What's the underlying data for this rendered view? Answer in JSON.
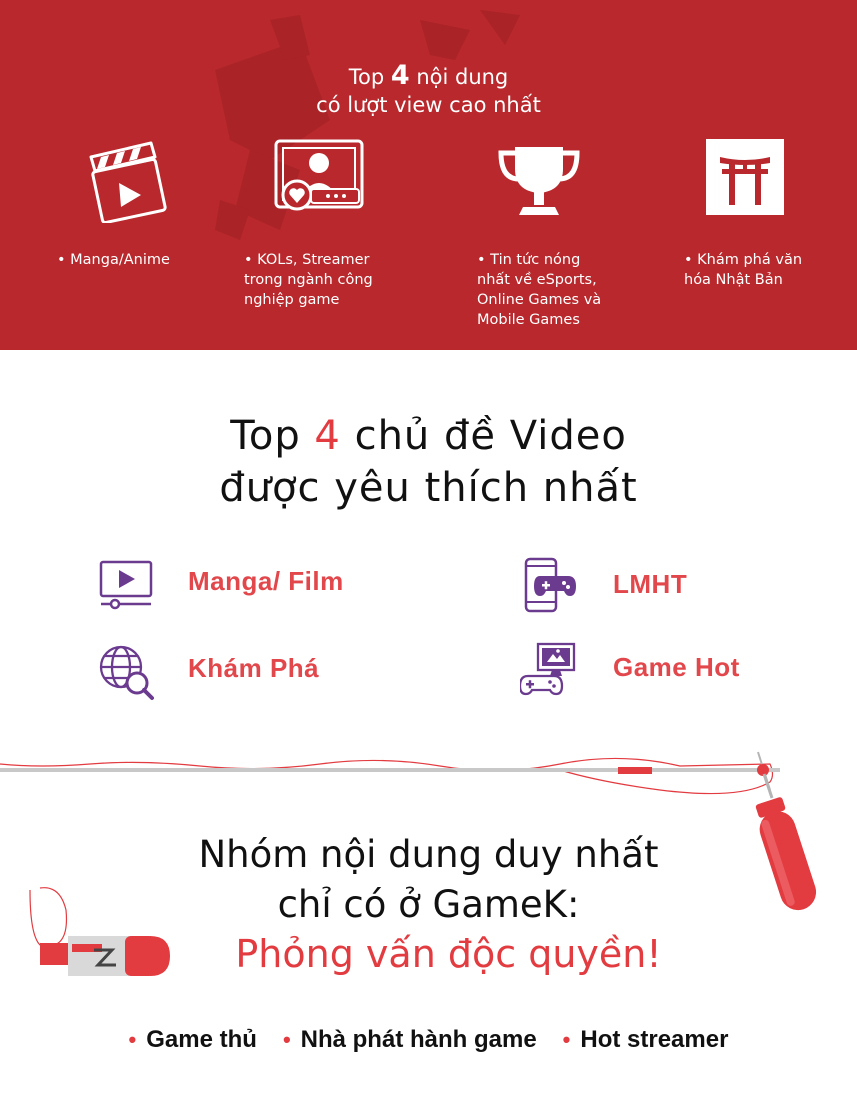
{
  "band": {
    "title_prefix": "Top ",
    "title_number": "4",
    "title_suffix": " nội dung",
    "title_line2": "có lượt view cao nhất",
    "background": "#b8282c",
    "categories": [
      {
        "icon": "clapperboard-icon",
        "lines": [
          "• Manga/Anime"
        ]
      },
      {
        "icon": "streamer-icon",
        "lines": [
          "• KOLs, Streamer",
          "trong ngành công",
          "nghiệp game"
        ]
      },
      {
        "icon": "trophy-icon",
        "lines": [
          "• Tin tức nóng",
          "nhất về eSports,",
          "Online Games và",
          "Mobile Games"
        ]
      },
      {
        "icon": "torii-gate-icon",
        "lines": [
          "• Khám phá văn",
          "hóa Nhật Bản"
        ]
      }
    ]
  },
  "video_section": {
    "title_prefix": "Top ",
    "title_number": "4",
    "title_suffix": " chủ đề Video",
    "title_line2": "được yêu thích nhất",
    "topics": [
      {
        "icon": "video-player-icon",
        "label": "Manga/ Film"
      },
      {
        "icon": "mobile-game-icon",
        "label": "LMHT"
      },
      {
        "icon": "globe-search-icon",
        "label": "Khám Phá"
      },
      {
        "icon": "game-console-icon",
        "label": "Game Hot"
      }
    ],
    "accent": "#e2474b",
    "icon_color": "#6b3b8f"
  },
  "exclusive_section": {
    "title_line1": "Nhóm nội dung duy nhất",
    "title_line2": "chỉ có ở GameK:",
    "subtitle": "Phỏng vấn độc quyền!",
    "bullets": [
      "Game thủ",
      "Nhà phát hành game",
      "Hot streamer"
    ],
    "accent": "#e23b40"
  }
}
